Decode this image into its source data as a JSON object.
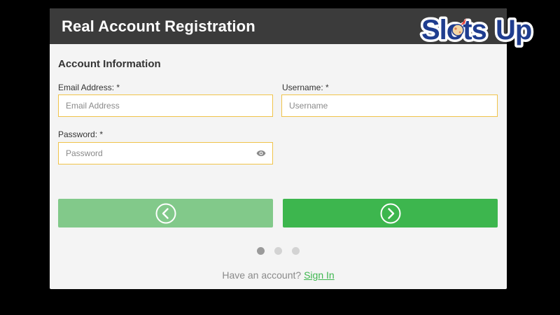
{
  "modal": {
    "title": "Real Account Registration",
    "section_title": "Account Information"
  },
  "form": {
    "email": {
      "label": "Email Address: *",
      "placeholder": "Email Address",
      "value": ""
    },
    "username": {
      "label": "Username: *",
      "placeholder": "Username",
      "value": ""
    },
    "password": {
      "label": "Password: *",
      "placeholder": "Password",
      "value": ""
    }
  },
  "navigation": {
    "prev_icon": "chevron-left-circle-icon",
    "next_icon": "chevron-right-circle-icon",
    "steps_total": 3,
    "step_current": 1
  },
  "footer": {
    "prompt": "Have an account?",
    "link_label": "Sign In"
  },
  "logo": {
    "text_part1": "Slots",
    "text_part2": "Up"
  },
  "colors": {
    "header_bg": "#3b3b3b",
    "body_bg": "#f4f4f4",
    "field_border": "#f0c34a",
    "next_btn": "#3db64e",
    "prev_btn": "#82c98a",
    "link": "#3db64e",
    "logo_blue": "#1f3d8f"
  }
}
